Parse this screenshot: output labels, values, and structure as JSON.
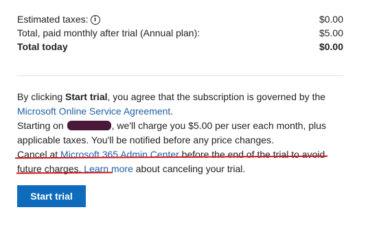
{
  "summary": {
    "rows": [
      {
        "label": "Estimated taxes:",
        "value": "$0.00",
        "has_info_icon": true
      },
      {
        "label": "Total, paid monthly after trial (Annual plan):",
        "value": "$5.00"
      },
      {
        "label": "Total today",
        "value": "$0.00",
        "bold": true
      }
    ],
    "info_icon": "info-circle-icon",
    "info_icon_glyph": "i"
  },
  "terms": {
    "line1_prefix": "By clicking ",
    "line1_bold": "Start trial",
    "line1_suffix": ", you agree that the subscription is governed by the ",
    "service_agreement_link": "Microsoft Online Service Agreement",
    "line1_end": ".",
    "line2_prefix": "Starting on ",
    "line2_suffix": ", we'll charge you $5.00 per user each month, plus applicable taxes. You'll be notified before any price changes.",
    "line3_prefix": "Cancel at ",
    "admin_center_link": "Microsoft 365 Admin Center",
    "line3_suffix": " before the end of the trial to avoid future charges. ",
    "learn_more_link": "Learn more",
    "line3_end": " about canceling your trial."
  },
  "actions": {
    "start_trial_label": "Start trial"
  },
  "colors": {
    "link": "#1f5fa6",
    "button_bg": "#0f6cbd",
    "annotation_red": "#d0141a",
    "redaction": "#4a1838"
  }
}
